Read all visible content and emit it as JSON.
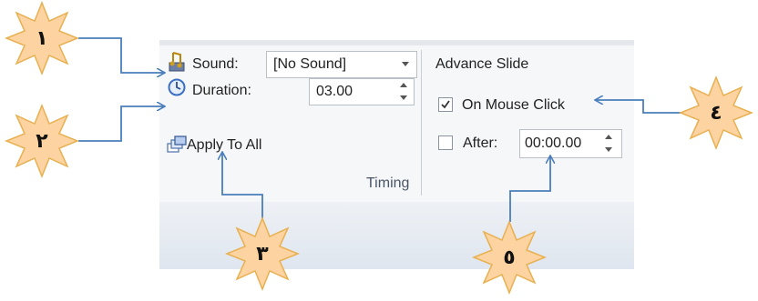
{
  "timing_group": {
    "label": "Timing",
    "sound": {
      "label": "Sound:",
      "value": "[No Sound]"
    },
    "duration": {
      "label": "Duration:",
      "value": "03.00"
    },
    "apply_to_all": {
      "label": "Apply To All"
    }
  },
  "advance_slide": {
    "heading": "Advance Slide",
    "on_mouse_click": {
      "label": "On Mouse Click",
      "checked": true
    },
    "after": {
      "label": "After:",
      "value": "00:00.00",
      "checked": false
    }
  },
  "callouts": [
    {
      "label": "١"
    },
    {
      "label": "٢"
    },
    {
      "label": "٣"
    },
    {
      "label": "٤"
    },
    {
      "label": "٥"
    }
  ],
  "colors": {
    "callout_fill": "#fcd3a1",
    "callout_stroke": "#e8b050",
    "arrow": "#4a7ebb",
    "panel_bg": "#f6f7f9"
  }
}
